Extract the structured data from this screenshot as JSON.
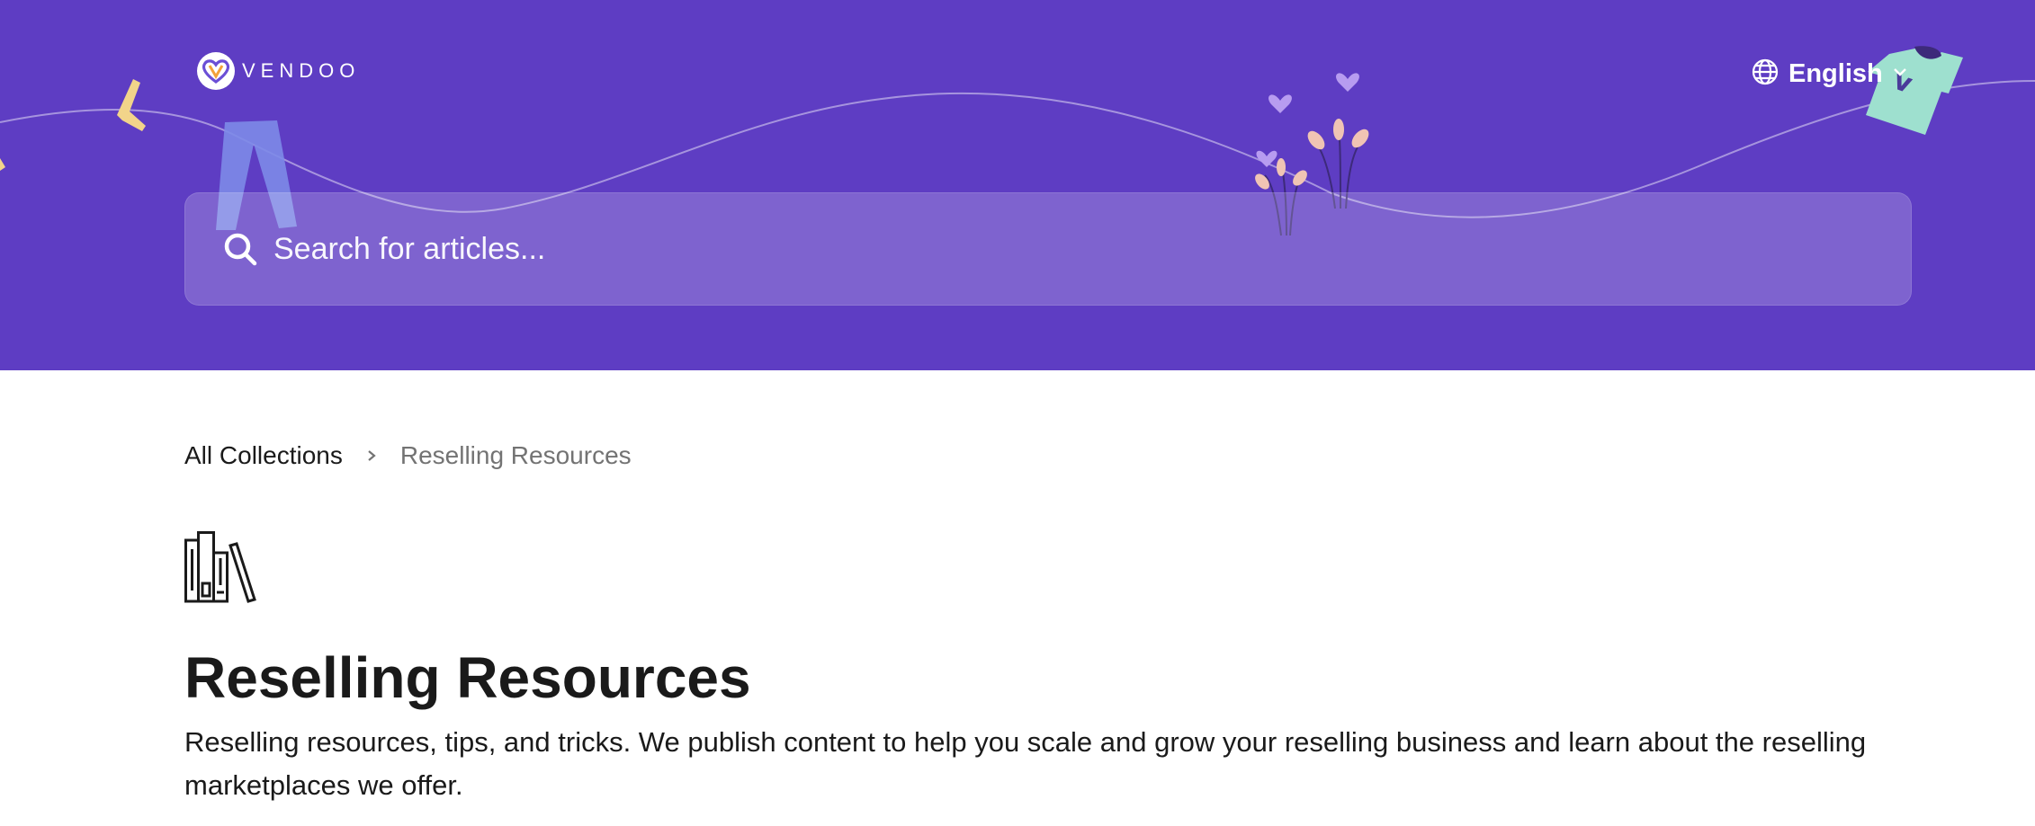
{
  "header": {
    "logo_text": "VENDOO",
    "language": "English",
    "brand_color": "#5e3dc3"
  },
  "search": {
    "placeholder": "Search for articles..."
  },
  "breadcrumb": {
    "root": "All Collections",
    "current": "Reselling Resources"
  },
  "collection": {
    "icon": "books-icon",
    "title": "Reselling Resources",
    "description": "Reselling resources, tips, and tricks. We publish content to help you scale and grow your reselling business and learn about the reselling marketplaces we offer."
  }
}
